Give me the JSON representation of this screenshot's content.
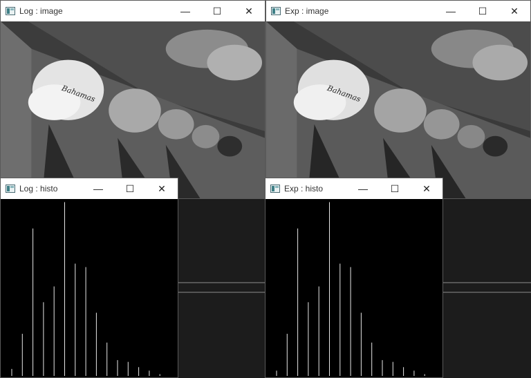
{
  "windows": {
    "log_image": {
      "title": "Log : image",
      "controls": {
        "minimize": "—",
        "maximize": "☐",
        "close": "✕"
      }
    },
    "exp_image": {
      "title": "Exp : image",
      "controls": {
        "minimize": "—",
        "maximize": "☐",
        "close": "✕"
      }
    },
    "log_histo": {
      "title": "Log : histo",
      "controls": {
        "minimize": "—",
        "maximize": "☐",
        "close": "✕"
      }
    },
    "exp_histo": {
      "title": "Exp : histo",
      "controls": {
        "minimize": "—",
        "maximize": "☐",
        "close": "✕"
      }
    }
  },
  "image_content": {
    "cap_text": "Bahamas"
  },
  "histograms": {
    "log": [
      0.04,
      0.24,
      0.84,
      0.42,
      0.51,
      0.99,
      0.64,
      0.62,
      0.36,
      0.19,
      0.09,
      0.08,
      0.05,
      0.03,
      0.01
    ],
    "exp": [
      0.03,
      0.24,
      0.84,
      0.42,
      0.51,
      0.99,
      0.64,
      0.62,
      0.36,
      0.19,
      0.09,
      0.08,
      0.05,
      0.03,
      0.01
    ]
  }
}
